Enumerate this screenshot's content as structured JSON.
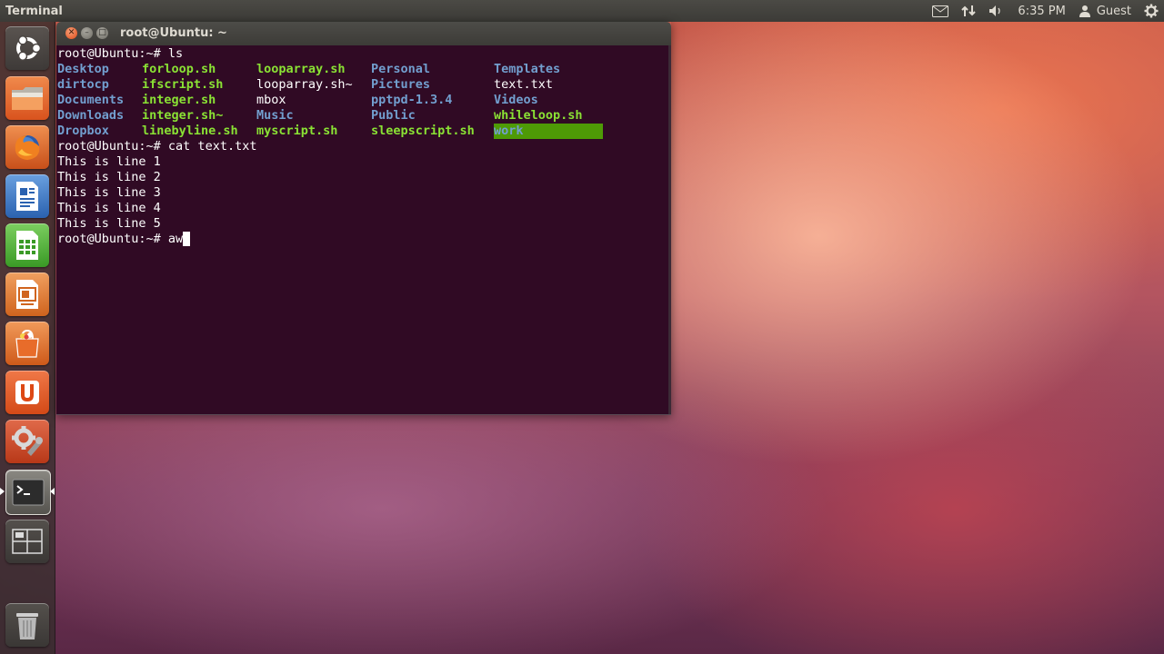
{
  "top_panel": {
    "app_title": "Terminal",
    "time": "6:35 PM",
    "user": "Guest",
    "icons": [
      "mail-icon",
      "network-icon",
      "volume-icon",
      "gear-icon"
    ]
  },
  "launcher": {
    "items": [
      {
        "name": "dash-home",
        "icon": "ubuntu-logo-icon"
      },
      {
        "name": "home-folder",
        "icon": "folder-icon"
      },
      {
        "name": "firefox",
        "icon": "firefox-icon"
      },
      {
        "name": "libreoffice-writer",
        "icon": "writer-icon"
      },
      {
        "name": "libreoffice-calc",
        "icon": "calc-icon"
      },
      {
        "name": "libreoffice-impress",
        "icon": "impress-icon"
      },
      {
        "name": "software-center",
        "icon": "shopping-bag-icon"
      },
      {
        "name": "ubuntu-one",
        "icon": "ubuntu-one-icon"
      },
      {
        "name": "system-settings",
        "icon": "settings-wrench-icon"
      },
      {
        "name": "terminal",
        "icon": "terminal-icon"
      },
      {
        "name": "workspace-switcher",
        "icon": "workspace-icon"
      },
      {
        "name": "trash",
        "icon": "trash-icon"
      }
    ],
    "colors": {
      "accent": "#dd4814"
    }
  },
  "terminal": {
    "window_title": "root@Ubuntu: ~",
    "prompt": "root@Ubuntu:~#",
    "cmd1": " ls",
    "ls_rows": [
      [
        {
          "t": "Desktop",
          "c": "dir"
        },
        {
          "t": "forloop.sh",
          "c": "exec"
        },
        {
          "t": "looparray.sh",
          "c": "exec"
        },
        {
          "t": "Personal",
          "c": "dir"
        },
        {
          "t": "Templates",
          "c": "dir"
        }
      ],
      [
        {
          "t": "dirtocp",
          "c": "dir"
        },
        {
          "t": "ifscript.sh",
          "c": "exec"
        },
        {
          "t": "looparray.sh~",
          "c": "plain"
        },
        {
          "t": "Pictures",
          "c": "dir"
        },
        {
          "t": "text.txt",
          "c": "plain"
        }
      ],
      [
        {
          "t": "Documents",
          "c": "dir"
        },
        {
          "t": "integer.sh",
          "c": "exec"
        },
        {
          "t": "mbox",
          "c": "plain"
        },
        {
          "t": "pptpd-1.3.4",
          "c": "dir"
        },
        {
          "t": "Videos",
          "c": "dir"
        }
      ],
      [
        {
          "t": "Downloads",
          "c": "dir"
        },
        {
          "t": "integer.sh~",
          "c": "exec"
        },
        {
          "t": "Music",
          "c": "dir"
        },
        {
          "t": "Public",
          "c": "dir"
        },
        {
          "t": "whileloop.sh",
          "c": "exec"
        }
      ],
      [
        {
          "t": "Dropbox",
          "c": "dir"
        },
        {
          "t": "linebyline.sh",
          "c": "exec"
        },
        {
          "t": "myscript.sh",
          "c": "exec"
        },
        {
          "t": "sleepscript.sh",
          "c": "exec"
        },
        {
          "t": "work",
          "c": "hl"
        }
      ]
    ],
    "cmd2": " cat text.txt",
    "output_lines": [
      "This is line 1",
      "This is line 2",
      "This is line 3",
      "This is line 4",
      "This is line 5"
    ],
    "cmd3": " aw",
    "colors": {
      "background": "#300a24",
      "dir": "#729fcf",
      "exec": "#8ae234",
      "highlight_bg": "#4e9a06"
    }
  }
}
